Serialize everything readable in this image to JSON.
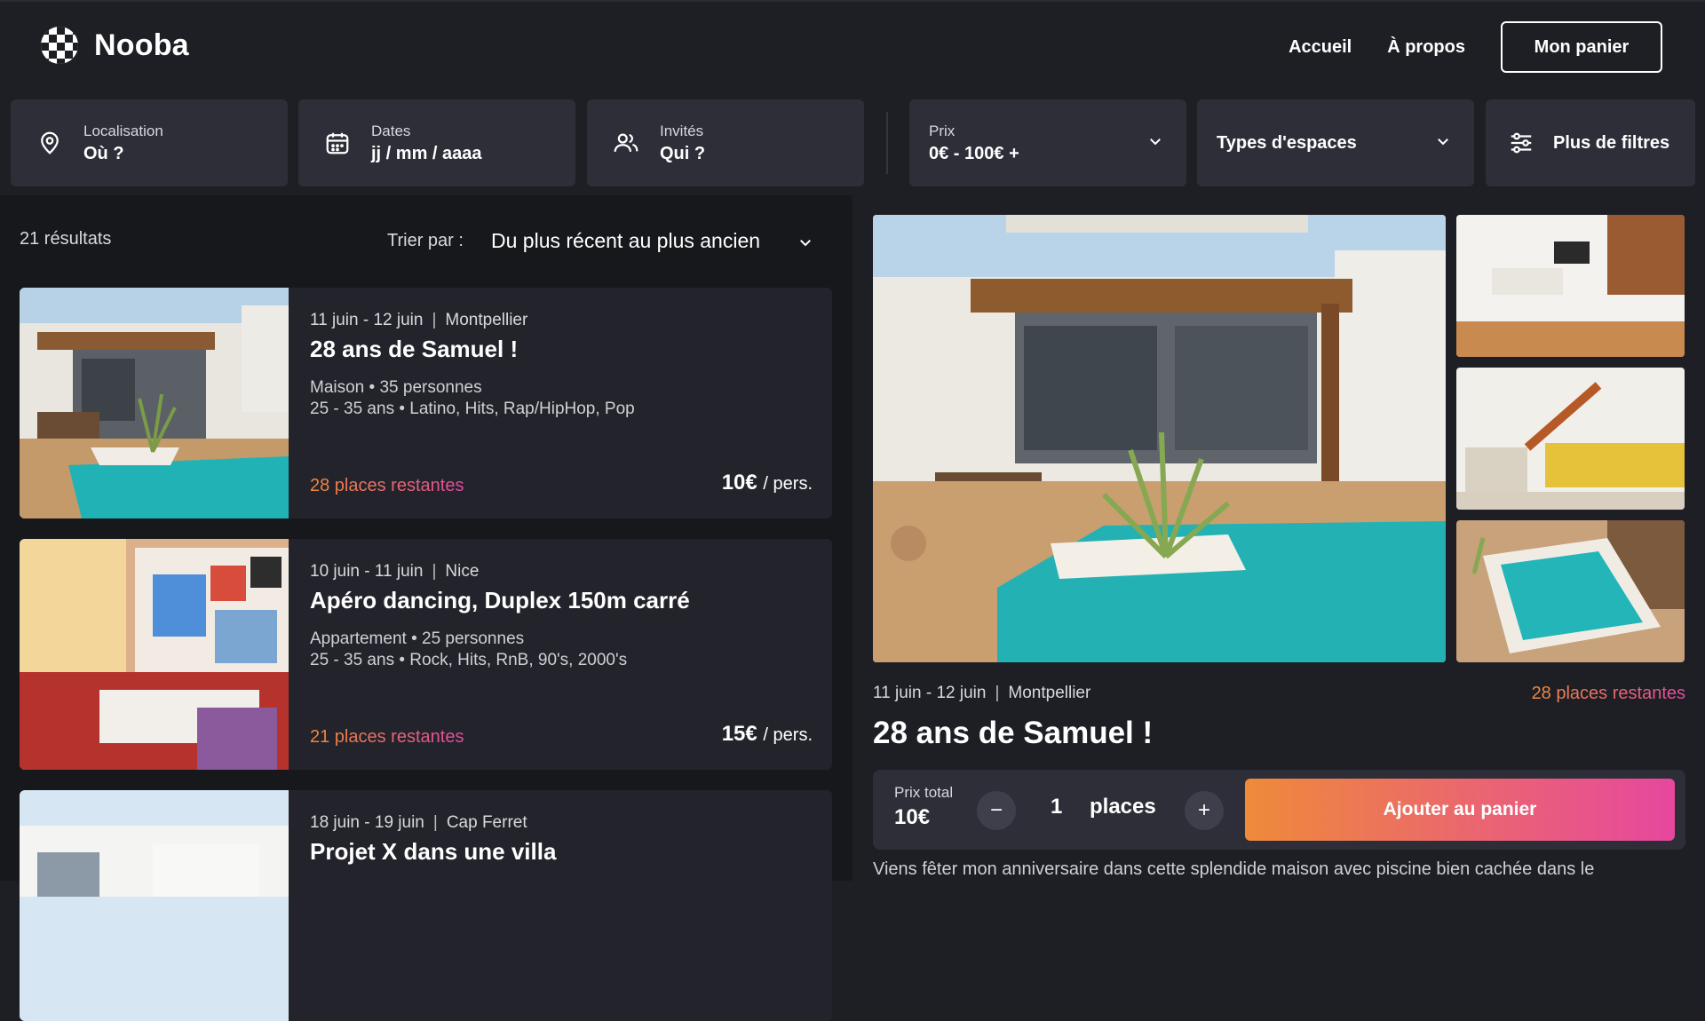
{
  "brand": {
    "name": "Nooba"
  },
  "nav": {
    "home": "Accueil",
    "about": "À propos",
    "cart": "Mon panier"
  },
  "filters": {
    "location": {
      "label": "Localisation",
      "value": "Où ?"
    },
    "dates": {
      "label": "Dates",
      "value": "jj / mm / aaaa"
    },
    "guests": {
      "label": "Invités",
      "value": "Qui ?"
    },
    "price": {
      "label": "Prix",
      "value": "0€ - 100€ +"
    },
    "space_types": "Types d'espaces",
    "more_filters": "Plus de filtres"
  },
  "list": {
    "results": "21 résultats",
    "sort_label": "Trier par :",
    "sort_value": "Du plus récent au plus ancien",
    "cards": [
      {
        "dates": "11 juin - 12 juin",
        "city": "Montpellier",
        "title": "28 ans de Samuel !",
        "line1": "Maison • 35 personnes",
        "line2": "25 - 35 ans • Latino, Hits, Rap/HipHop, Pop",
        "places": "28 places restantes",
        "price": "10€",
        "per": "/ pers."
      },
      {
        "dates": "10 juin - 11 juin",
        "city": "Nice",
        "title": "Apéro dancing, Duplex 150m carré",
        "line1": "Appartement • 25 personnes",
        "line2": "25 - 35 ans • Rock, Hits, RnB, 90's, 2000's",
        "places": "21 places restantes",
        "price": "15€",
        "per": "/ pers."
      },
      {
        "dates": "18 juin - 19 juin",
        "city": "Cap Ferret",
        "title": "Projet X dans une villa",
        "line1": "",
        "line2": "",
        "places": "",
        "price": "",
        "per": ""
      }
    ]
  },
  "detail": {
    "dates": "11 juin - 12 juin",
    "city": "Montpellier",
    "places": "28 places restantes",
    "title": "28 ans de Samuel !",
    "total_label": "Prix total",
    "total_value": "10€",
    "minus": "−",
    "plus": "+",
    "qty": "1",
    "qty_unit": "places",
    "add_to_cart": "Ajouter au panier",
    "description": "Viens fêter mon anniversaire dans cette splendide maison avec piscine bien cachée dans le"
  },
  "colors": {
    "accent_start": "#ef8a3a",
    "accent_end": "#e6479e",
    "pool": "#1fb3b5"
  },
  "icons": [
    "checker-globe-icon",
    "location-pin-icon",
    "calendar-icon",
    "users-icon",
    "chevron-down-icon",
    "sliders-icon"
  ]
}
